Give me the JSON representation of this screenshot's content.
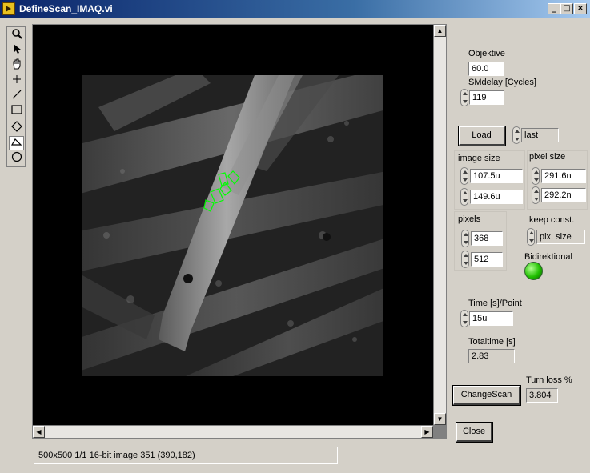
{
  "window": {
    "title": "DefineScan_IMAQ.vi",
    "buttons": [
      "_",
      "□",
      "×"
    ]
  },
  "tools": [
    "zoom-icon",
    "arrow-icon",
    "pan-hand-icon",
    "point-icon",
    "line-icon",
    "rectangle-icon",
    "rotated-rectangle-icon",
    "freehand-icon",
    "oval-icon"
  ],
  "status": {
    "text": "500x500 1/1 16-bit image 351    (390,182)"
  },
  "panel": {
    "objektive_label": "Objektive",
    "objektive_value": "60.0",
    "smdelay_label": "SMdelay [Cycles]",
    "smdelay_value": "119",
    "load_label": "Load",
    "load_select": "last",
    "image_size_label": "image size",
    "image_size_x": "107.5u",
    "image_size_y": "149.6u",
    "pixel_size_label": "pixel size",
    "pixel_size_x": "291.6n",
    "pixel_size_y": "292.2n",
    "pixels_label": "pixels",
    "pixels_x": "368",
    "pixels_y": "512",
    "keep_const_label": "keep const.",
    "keep_const_value": "pix. size",
    "bidirektional_label": "Bidirektional",
    "bidirektional_on": true,
    "time_label": "Time [s]/Point",
    "time_value": "15u",
    "totaltime_label": "Totaltime [s]",
    "totaltime_value": "2.83",
    "changescan_label": "ChangeScan",
    "turnloss_label": "Turn loss %",
    "turnloss_value": "3.804",
    "close_label": "Close"
  },
  "colors": {
    "led_on": "#20c000",
    "roi": "#00ff00",
    "titlebar": "#0a246a"
  }
}
